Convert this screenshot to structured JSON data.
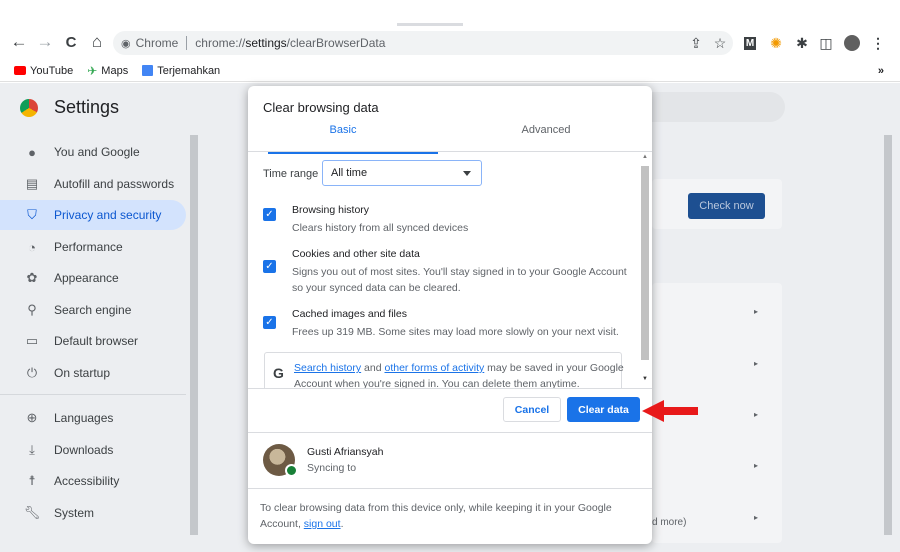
{
  "browser": {
    "omnibox": {
      "chip": "Chrome",
      "url_prefix": "chrome://",
      "url_host": "settings",
      "url_path": "/clearBrowserData"
    },
    "bookmarks": [
      {
        "label": "YouTube",
        "icon": "youtube-icon",
        "color": "#ff0000"
      },
      {
        "label": "Maps",
        "icon": "maps-icon",
        "color": "#34a853"
      },
      {
        "label": "Terjemahkan",
        "icon": "translate-icon",
        "color": "#4285f4"
      }
    ],
    "bookmarks_more": "»"
  },
  "settings": {
    "title": "Settings",
    "sidebar": [
      {
        "label": "You and Google",
        "icon": "person-icon"
      },
      {
        "label": "Autofill and passwords",
        "icon": "clipboard-icon"
      },
      {
        "label": "Privacy and security",
        "icon": "shield-icon",
        "active": true
      },
      {
        "label": "Performance",
        "icon": "speedometer-icon"
      },
      {
        "label": "Appearance",
        "icon": "palette-icon"
      },
      {
        "label": "Search engine",
        "icon": "search-icon"
      },
      {
        "label": "Default browser",
        "icon": "browser-icon"
      },
      {
        "label": "On startup",
        "icon": "power-icon"
      },
      {
        "label": "Languages",
        "icon": "globe-icon"
      },
      {
        "label": "Downloads",
        "icon": "download-icon"
      },
      {
        "label": "Accessibility",
        "icon": "accessibility-icon"
      },
      {
        "label": "System",
        "icon": "wrench-icon"
      }
    ],
    "check_now": "Check now",
    "partial_text": "d more)"
  },
  "dialog": {
    "title": "Clear browsing data",
    "tabs": {
      "basic": "Basic",
      "advanced": "Advanced"
    },
    "time_range": {
      "label": "Time range",
      "value": "All time"
    },
    "options": [
      {
        "title": "Browsing history",
        "desc": "Clears history from all synced devices",
        "checked": true
      },
      {
        "title": "Cookies and other site data",
        "desc": "Signs you out of most sites. You'll stay signed in to your Google Account so your synced data can be cleared.",
        "checked": true
      },
      {
        "title": "Cached images and files",
        "desc": "Frees up 319 MB. Some sites may load more slowly on your next visit.",
        "checked": true
      }
    ],
    "google_notice": {
      "link1": "Search history",
      "mid": " and ",
      "link2": "other forms of activity",
      "rest": " may be saved in your Google Account when you're signed in. You can delete them anytime."
    },
    "cancel": "Cancel",
    "clear": "Clear data",
    "account": {
      "name": "Gusti Afriansyah",
      "sync": "Syncing to"
    },
    "footer": {
      "text": "To clear browsing data from this device only, while keeping it in your Google Account, ",
      "link": "sign out",
      "end": "."
    }
  }
}
